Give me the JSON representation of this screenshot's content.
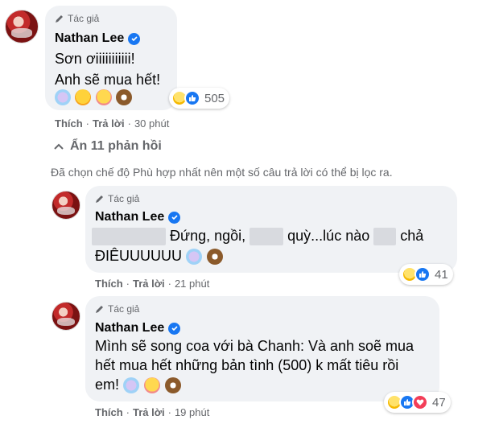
{
  "comment": {
    "author_tag": "Tác giả",
    "author_name": "Nathan Lee",
    "lines": [
      "Sơn ơiiiiiiiiiii!",
      "Anh sẽ mua hết!"
    ],
    "emojis": [
      "unicorn-emoji",
      "rofl-emoji",
      "smiling-hearts-emoji",
      "coconut-emoji"
    ],
    "reaction_count": "505",
    "reactions": [
      "haha",
      "like"
    ],
    "actions": {
      "like": "Thích",
      "reply": "Trả lời",
      "time": "30 phút"
    }
  },
  "hide_replies": "Ẩn 11 phản hồi",
  "notice": "Đã chọn chế độ Phù hợp nhất nên một số câu trả lời có thể bị lọc ra.",
  "replies": [
    {
      "author_tag": "Tác giả",
      "author_name": "Nathan Lee",
      "line1_parts": [
        "Đứng, ngồi,",
        "quỳ...lúc nào",
        "chả"
      ],
      "line2": "ĐIÊUUUUUU",
      "reaction_count": "41",
      "reactions": [
        "haha",
        "like"
      ],
      "actions": {
        "like": "Thích",
        "reply": "Trả lời",
        "time": "21 phút"
      }
    },
    {
      "author_tag": "Tác giả",
      "author_name": "Nathan Lee",
      "lines": [
        "Mình sẽ song coa với bà Chanh: Và anh soẽ mua",
        "hết mua hết những bản tình (500) k mất tiêu rồi",
        "em!"
      ],
      "reaction_count": "47",
      "reactions": [
        "haha",
        "like",
        "love"
      ],
      "actions": {
        "like": "Thích",
        "reply": "Trả lời",
        "time": "19 phút"
      }
    }
  ],
  "colors": {
    "bubble": "#f0f2f5",
    "secondary_text": "#65676b",
    "verified": "#1877f2",
    "love": "#f33e58"
  }
}
